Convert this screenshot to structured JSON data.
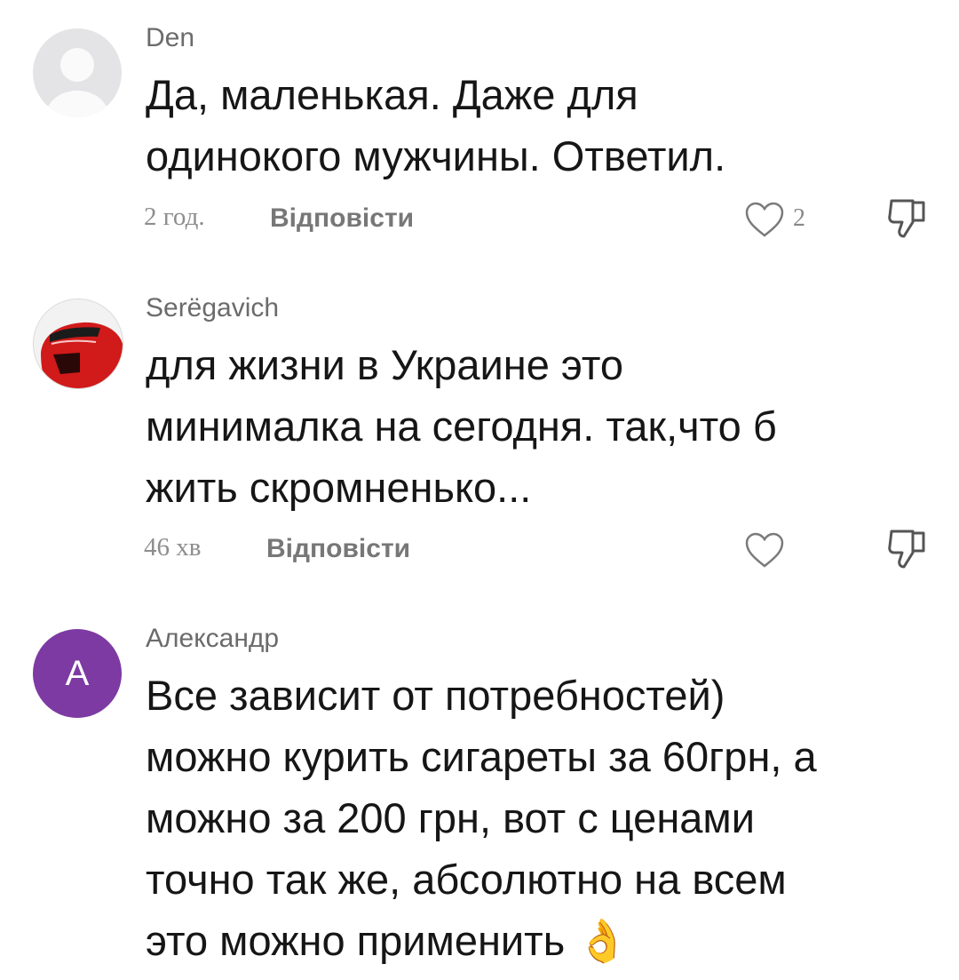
{
  "comments": [
    {
      "username": "Den",
      "avatar": "default-user-icon",
      "text_lines": [
        "Да, маленькая. Даже для",
        "одинокого мужчины. Ответил."
      ],
      "time": "2 год.",
      "reply_label": "Відповісти",
      "likes": "2"
    },
    {
      "username": "Serëgavich",
      "avatar": "red-car-photo",
      "text_lines": [
        "для жизни в Украине это",
        "минималка на сегодня. так,что б",
        "жить скромненько..."
      ],
      "time": "46 хв",
      "reply_label": "Відповісти",
      "likes": ""
    },
    {
      "username": "Александр",
      "avatar_letter": "A",
      "avatar_color": "#7d3aa3",
      "text_lines": [
        "Все зависит от потребностей)",
        "можно курить сигареты за 60грн, а",
        "можно за 200 грн, вот с ценами",
        "точно так же, абсолютно на всем",
        "это можно применить 👌"
      ]
    }
  ],
  "icons": {
    "like": "heart-outline-icon",
    "dislike": "thumbs-down-icon"
  }
}
